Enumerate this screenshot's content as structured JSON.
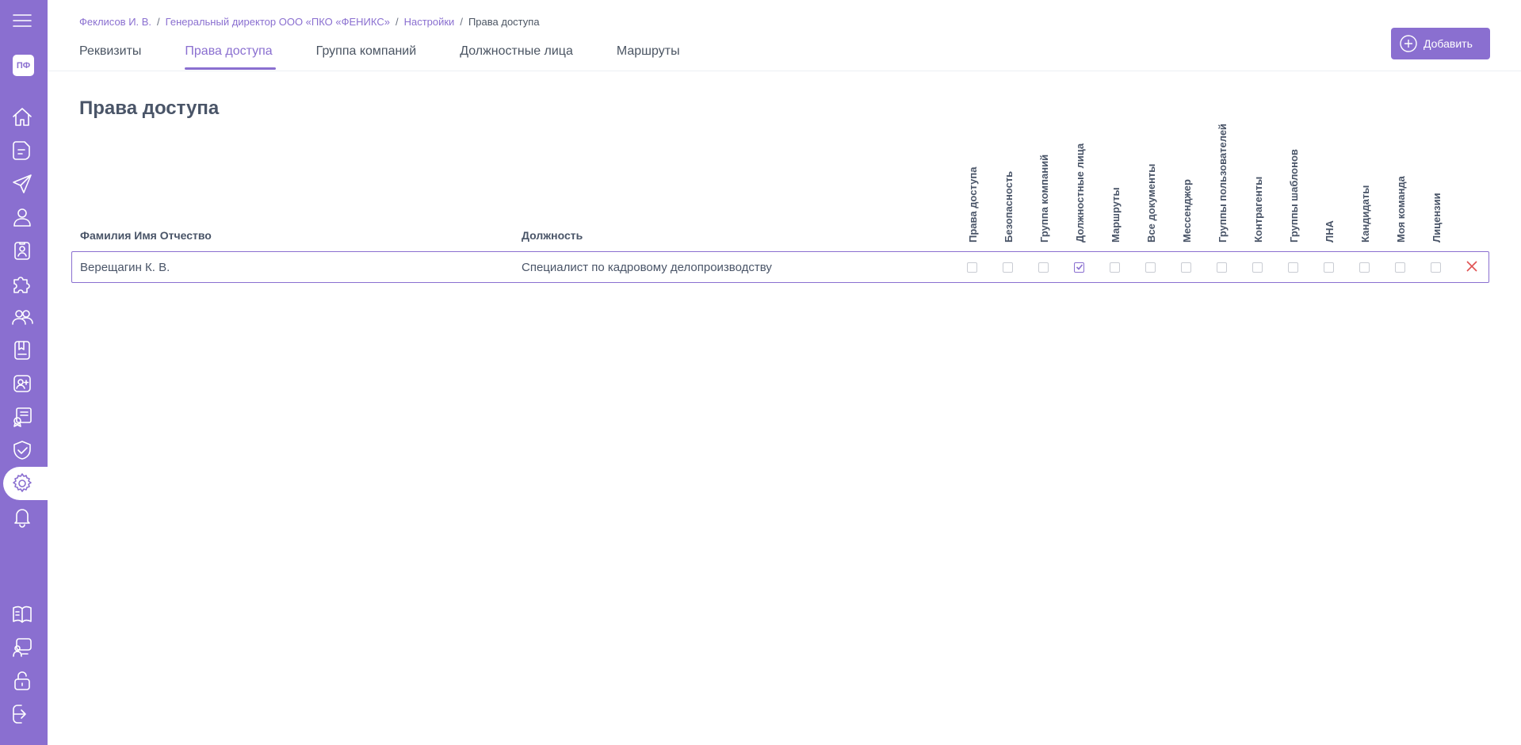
{
  "sidebar": {
    "avatar_initials": "ПФ",
    "accent_color": "#8a6fd0",
    "items": [
      {
        "icon": "menu-icon"
      },
      {
        "icon": "home-icon"
      },
      {
        "icon": "document-icon"
      },
      {
        "icon": "send-icon"
      },
      {
        "icon": "user-icon"
      },
      {
        "icon": "badge-icon"
      },
      {
        "icon": "puzzle-icon"
      },
      {
        "icon": "users-icon"
      },
      {
        "icon": "book-icon"
      },
      {
        "icon": "add-user-card-icon"
      },
      {
        "icon": "certificate-icon"
      },
      {
        "icon": "shield-check-icon"
      },
      {
        "icon": "gear-icon",
        "active": true
      },
      {
        "icon": "bell-icon"
      },
      {
        "icon": "open-book-icon"
      },
      {
        "icon": "presentation-icon"
      },
      {
        "icon": "unlock-icon"
      },
      {
        "icon": "logout-icon"
      }
    ]
  },
  "breadcrumb": [
    "Феклисов И. В.",
    "Генеральный директор ООО «ПКО «ФЕНИКС»",
    "Настройки",
    "Права доступа"
  ],
  "tabs": [
    {
      "label": "Реквизиты"
    },
    {
      "label": "Права доступа",
      "active": true
    },
    {
      "label": "Группа компаний"
    },
    {
      "label": "Должностные лица"
    },
    {
      "label": "Маршруты"
    }
  ],
  "add_button": {
    "label": "Добавить",
    "icon": "plus-circle-icon"
  },
  "page_title": "Права доступа",
  "table": {
    "col_name": "Фамилия Имя Отчество",
    "col_position": "Должность",
    "permission_columns": [
      "Права доступа",
      "Безопасность",
      "Группа компаний",
      "Должностные лица",
      "Маршруты",
      "Все документы",
      "Мессенджер",
      "Группы пользователей",
      "Контрагенты",
      "Группы шаблонов",
      "ЛНА",
      "Кандидаты",
      "Моя команда",
      "Лицензии"
    ],
    "rows": [
      {
        "name": "Верещагин К. В.",
        "position": "Специалист по кадровому делопроизводству",
        "permissions": [
          false,
          false,
          false,
          true,
          false,
          false,
          false,
          false,
          false,
          false,
          false,
          false,
          false,
          false
        ],
        "delete_icon": "close-icon"
      }
    ]
  }
}
